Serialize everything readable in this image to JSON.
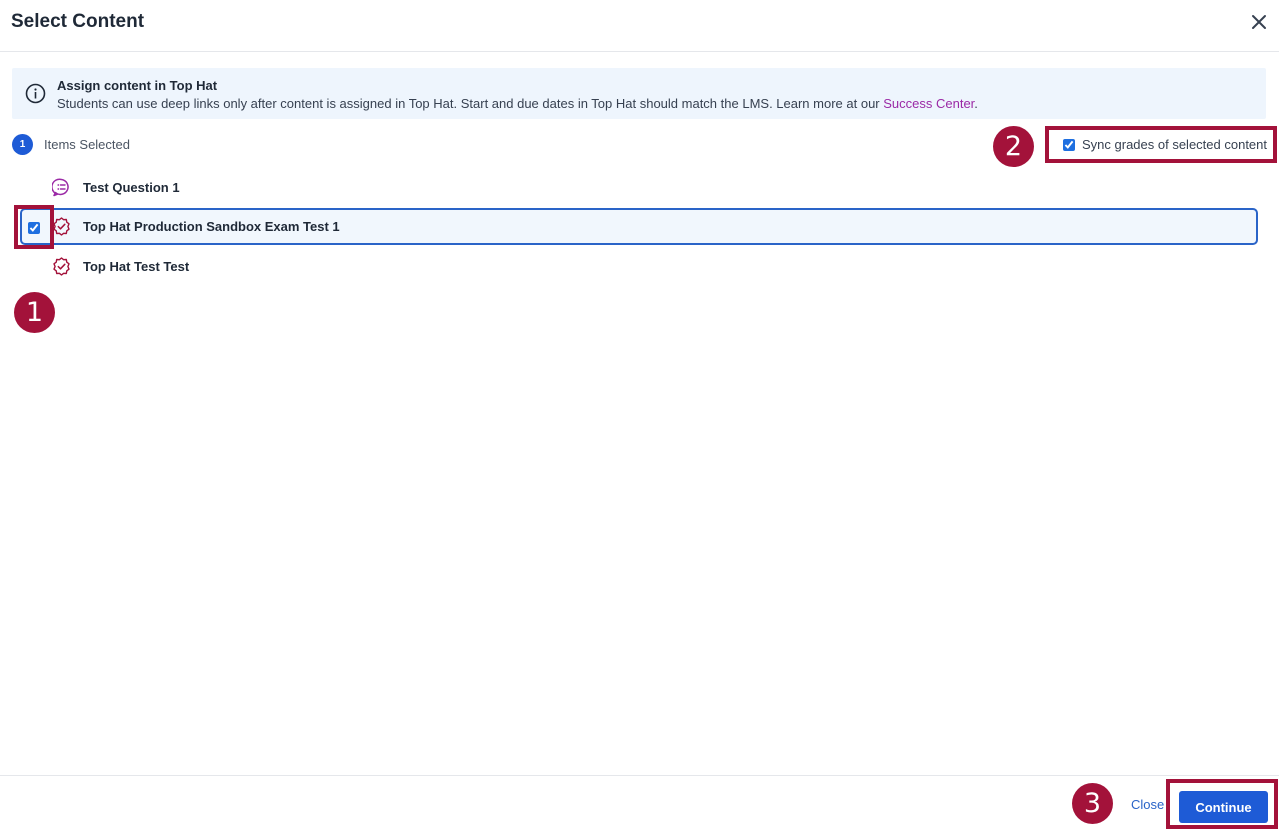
{
  "dialog": {
    "title": "Select Content",
    "close_icon": "close-icon"
  },
  "banner": {
    "icon": "info-icon",
    "title": "Assign content in Top Hat",
    "text": "Students can use deep links only after content is assigned in Top Hat. Start and due dates in Top Hat should match the LMS. Learn more at our ",
    "link_text": "Success Center",
    "text_end": "."
  },
  "selection": {
    "count": "1",
    "label": "Items Selected"
  },
  "sync": {
    "label": "Sync grades of selected content",
    "checked": true
  },
  "items": [
    {
      "label": "Test Question 1",
      "icon": "question-icon",
      "selected": false
    },
    {
      "label": "Top Hat Production Sandbox Exam Test 1",
      "icon": "exam-badge-icon",
      "selected": true
    },
    {
      "label": "Top Hat Test Test",
      "icon": "exam-badge-icon",
      "selected": false
    }
  ],
  "annotations": [
    "1",
    "2",
    "3"
  ],
  "footer": {
    "close_label": "Close",
    "continue_label": "Continue"
  },
  "colors": {
    "accent": "#1e5bd6",
    "annotation": "#a3123a",
    "item_icon": "#a3123a",
    "question_icon": "#9b2aa6",
    "link": "#9b2aa6",
    "banner_bg": "#eef5fd"
  }
}
